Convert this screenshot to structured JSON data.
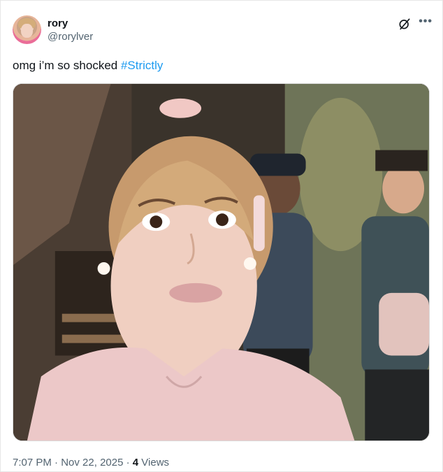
{
  "author": {
    "display_name": "rory",
    "handle": "@rorylver",
    "avatar_icon": "profile-photo"
  },
  "tweet": {
    "text": "omg i’m so shocked ",
    "hashtag": "#Strictly"
  },
  "media": {
    "description_icon": "photo"
  },
  "meta": {
    "time": "7:07 PM",
    "separator": " · ",
    "date": "Nov 22, 2025",
    "separator2": " · ",
    "views_count": "4",
    "views_label": " Views"
  },
  "icons": {
    "grok": "grok-icon",
    "more": "more-icon"
  },
  "colors": {
    "link": "#1d9bf0",
    "secondary_text": "#536471",
    "primary_text": "#0f1419"
  }
}
